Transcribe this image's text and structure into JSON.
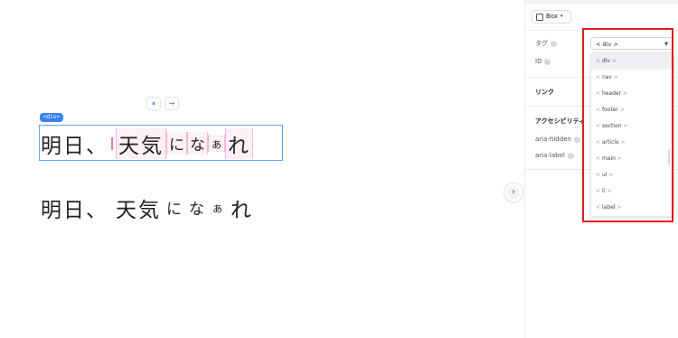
{
  "canvas": {
    "toolbar": {
      "align_icon": "⏸",
      "arrow_icon": "→"
    },
    "selection_badge": "<div>",
    "text_row1": {
      "seg1": "明日、",
      "seg2": "天気",
      "seg3": "に",
      "seg4": "な",
      "seg5": "ぁ",
      "seg6": "れ"
    },
    "text_row2": {
      "seg1": "明日、",
      "seg2": "天気",
      "seg3": "に",
      "seg4": "な",
      "seg5": "ぁ",
      "seg6": "れ"
    },
    "collapse_icon": "›"
  },
  "panel": {
    "element_type": "Box",
    "tag_label": "タグ",
    "id_label": "ID",
    "link_section": "リンク",
    "accessibility_section": "アクセシビリティ",
    "aria_hidden_label": "aria-hidden",
    "aria_label_label": "aria-label",
    "tag_select_value": "< div >",
    "tag_options": [
      {
        "name": "div"
      },
      {
        "name": "nav"
      },
      {
        "name": "header"
      },
      {
        "name": "footer"
      },
      {
        "name": "section"
      },
      {
        "name": "article"
      },
      {
        "name": "main"
      },
      {
        "name": "ul"
      },
      {
        "name": "li"
      },
      {
        "name": "label"
      }
    ],
    "highlight_color": "#e11d1d"
  }
}
